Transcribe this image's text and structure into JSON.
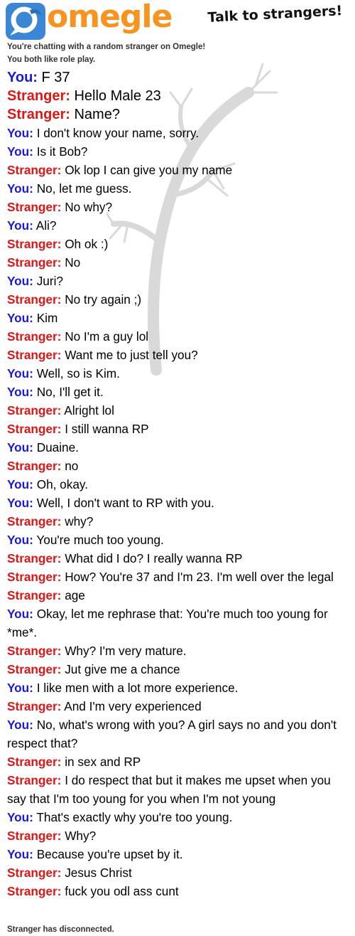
{
  "header": {
    "logo_text": "omegle",
    "tagline": "Talk to strangers!"
  },
  "status": {
    "chatting": "You're chatting with a random stranger on Omegle!",
    "interest": "You both like role play.",
    "disconnected": "Stranger has disconnected."
  },
  "labels": {
    "you": "You:",
    "stranger": "Stranger:"
  },
  "colors": {
    "you": "#1a1ad8",
    "stranger": "#e01515",
    "logo": "#f7931e"
  },
  "messages": [
    {
      "who": "you",
      "text": "F 37"
    },
    {
      "who": "stranger",
      "text": "Hello Male 23"
    },
    {
      "who": "stranger",
      "text": "Name?"
    },
    {
      "who": "you",
      "text": "I don't know your name, sorry."
    },
    {
      "who": "you",
      "text": "Is it Bob?"
    },
    {
      "who": "stranger",
      "text": "Ok lop I can give you my name"
    },
    {
      "who": "you",
      "text": "No, let me guess."
    },
    {
      "who": "stranger",
      "text": "No why?"
    },
    {
      "who": "you",
      "text": "Ali?"
    },
    {
      "who": "stranger",
      "text": "Oh ok :)"
    },
    {
      "who": "stranger",
      "text": "No"
    },
    {
      "who": "you",
      "text": "Juri?"
    },
    {
      "who": "stranger",
      "text": "No try again ;)"
    },
    {
      "who": "you",
      "text": "Kim"
    },
    {
      "who": "stranger",
      "text": "No I'm a guy lol"
    },
    {
      "who": "stranger",
      "text": "Want me to just tell you?"
    },
    {
      "who": "you",
      "text": "Well, so is Kim."
    },
    {
      "who": "you",
      "text": "No, I'll get it."
    },
    {
      "who": "stranger",
      "text": "Alright lol"
    },
    {
      "who": "stranger",
      "text": "I still wanna RP"
    },
    {
      "who": "you",
      "text": "Duaine."
    },
    {
      "who": "stranger",
      "text": "no"
    },
    {
      "who": "you",
      "text": "Oh, okay."
    },
    {
      "who": "you",
      "text": "Well, I don't want to RP with you."
    },
    {
      "who": "stranger",
      "text": "why?"
    },
    {
      "who": "you",
      "text": "You're much too young."
    },
    {
      "who": "stranger",
      "text": "What did I do? I really wanna RP"
    },
    {
      "who": "stranger",
      "text": "How? You're 37 and I'm 23. I'm well over the legal"
    },
    {
      "who": "stranger",
      "text": "age"
    },
    {
      "who": "you",
      "text": "Okay, let me rephrase that: You're much too young for *me*."
    },
    {
      "who": "stranger",
      "text": "Why? I'm very mature."
    },
    {
      "who": "stranger",
      "text": "Jut give me a chance"
    },
    {
      "who": "you",
      "text": "I like men with a lot more experience."
    },
    {
      "who": "stranger",
      "text": "And I'm very experienced"
    },
    {
      "who": "you",
      "text": "No, what's wrong with you? A girl says no and you don't respect that?"
    },
    {
      "who": "stranger",
      "text": "in sex and RP"
    },
    {
      "who": "stranger",
      "text": "I do respect that but it makes me upset when you say that I'm too young for you when I'm not young"
    },
    {
      "who": "you",
      "text": "That's exactly why you're too young."
    },
    {
      "who": "stranger",
      "text": "Why?"
    },
    {
      "who": "you",
      "text": "Because you're upset by it."
    },
    {
      "who": "stranger",
      "text": "Jesus Christ"
    },
    {
      "who": "stranger",
      "text": "fuck you odl ass cunt"
    }
  ]
}
